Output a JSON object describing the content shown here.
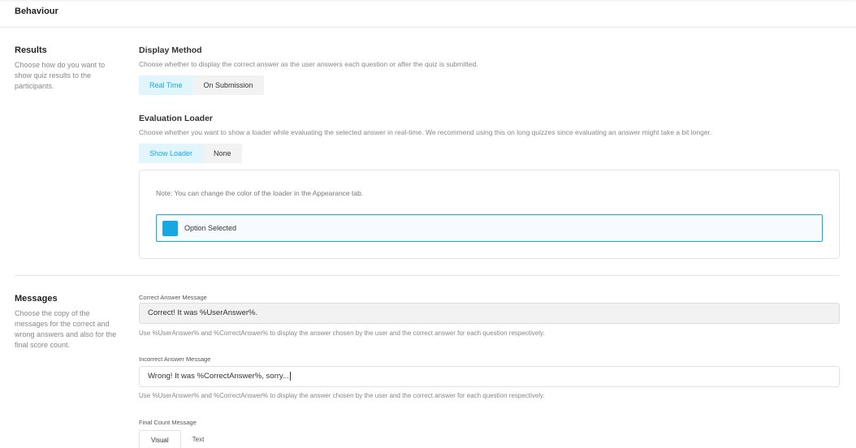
{
  "header": {
    "title": "Behaviour"
  },
  "results": {
    "title": "Results",
    "description": "Choose how do you want to show quiz results to the participants.",
    "display_method": {
      "label": "Display Method",
      "description": "Choose whether to display the correct answer as the user answers each question or after the quiz is submitted.",
      "options": [
        "Real Time",
        "On Submission"
      ],
      "selected": "Real Time"
    },
    "evaluation_loader": {
      "label": "Evaluation Loader",
      "description": "Choose whether you want to show a loader while evaluating the selected answer in real-time. We recommend using this on long quizzes since evaluating an answer might take a bit longer.",
      "options": [
        "Show Loader",
        "None"
      ],
      "selected": "Show Loader",
      "note": "Note: You can change the color of the loader in the Appearance tab.",
      "preview_label": "Option Selected"
    }
  },
  "messages": {
    "title": "Messages",
    "description": "Choose the copy of the messages for the correct and wrong answers and also for the final score count.",
    "correct": {
      "label": "Correct Answer Message",
      "value": "Correct! It was %UserAnswer%.",
      "help": "Use %UserAnswer% and %CorrectAnswer% to display the answer chosen by the user and the correct answer for each question respectively."
    },
    "incorrect": {
      "label": "Incorrect Answer Message",
      "value": "Wrong! It was %CorrectAnswer%, sorry...",
      "help": "Use %UserAnswer% and %CorrectAnswer% to display the answer chosen by the user and the correct answer for each question respectively."
    },
    "final_count": {
      "label": "Final Count Message",
      "tabs": [
        "Visual",
        "Text"
      ],
      "selected": "Visual"
    }
  },
  "colors": {
    "accent": "#17a8e3",
    "accent_bg": "#e1f5fd",
    "tab_bg": "#f2f2f2"
  }
}
